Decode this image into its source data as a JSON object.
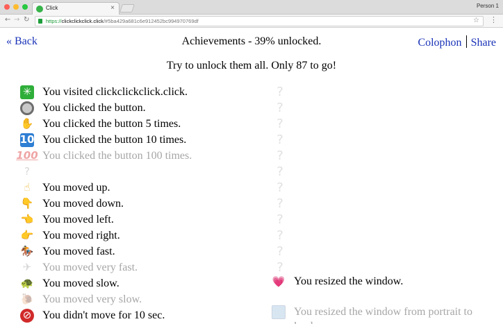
{
  "browser": {
    "tab_title": "Click",
    "tab_close": "×",
    "profile": "Person 1",
    "url_scheme": "https://",
    "url_host": "clickclickclick.click",
    "url_path": "/#5ba429a681c6e912452bc994970769df",
    "nav_back": "←",
    "nav_forward": "→",
    "nav_reload": "↻",
    "star": "☆",
    "menu": "⋮"
  },
  "header": {
    "back": "« Back",
    "title": "Achievements - 39% unlocked.",
    "colophon": "Colophon",
    "share": "Share"
  },
  "subtitle": "Try to unlock them all. Only 87 to go!",
  "achievements_left": [
    {
      "icon": "✳",
      "icon_name": "sparkle-icon",
      "cls": "sq-green",
      "label": "You visited clickclickclick.click.",
      "unlocked": true
    },
    {
      "icon": "",
      "icon_name": "radio-button-icon",
      "cls": "circ",
      "label": "You clicked the button.",
      "unlocked": true
    },
    {
      "icon": "✋",
      "icon_name": "raised-hand-icon",
      "cls": "hand",
      "label": "You clicked the button 5 times.",
      "unlocked": true
    },
    {
      "icon": "10",
      "icon_name": "keycap-ten-icon",
      "cls": "sq-blue",
      "label": "You clicked the button 10 times.",
      "unlocked": true
    },
    {
      "icon": "100",
      "icon_name": "hundred-points-icon",
      "cls": "hundred",
      "label": "You clicked the button 100 times.",
      "unlocked": false
    },
    {
      "icon": "?",
      "icon_name": "question-mark-icon",
      "cls": "grey",
      "label": "",
      "unlocked": false
    },
    {
      "icon": "☝",
      "icon_name": "pointing-up-icon",
      "cls": "hand",
      "label": "You moved up.",
      "unlocked": true
    },
    {
      "icon": "👇",
      "icon_name": "pointing-down-icon",
      "cls": "hand",
      "label": "You moved down.",
      "unlocked": true
    },
    {
      "icon": "👈",
      "icon_name": "pointing-left-icon",
      "cls": "hand",
      "label": "You moved left.",
      "unlocked": true
    },
    {
      "icon": "👉",
      "icon_name": "pointing-right-icon",
      "cls": "hand",
      "label": "You moved right.",
      "unlocked": true
    },
    {
      "icon": "🏇",
      "icon_name": "horse-racing-icon",
      "cls": "horse",
      "label": "You moved fast.",
      "unlocked": true
    },
    {
      "icon": "✈",
      "icon_name": "airplane-icon",
      "cls": "grey",
      "label": "You moved very fast.",
      "unlocked": false
    },
    {
      "icon": "🐢",
      "icon_name": "turtle-icon",
      "cls": "turtle",
      "label": "You moved slow.",
      "unlocked": true
    },
    {
      "icon": "🐌",
      "icon_name": "snail-icon",
      "cls": "grey",
      "label": "You moved very slow.",
      "unlocked": false
    },
    {
      "icon": "⊘",
      "icon_name": "no-pedestrians-icon",
      "cls": "red-circ",
      "label": "You didn't move for 10 sec.",
      "unlocked": true
    }
  ],
  "achievements_right": [
    {
      "icon": "💗",
      "icon_name": "growing-heart-icon",
      "cls": "pink",
      "label": "You resized the window.",
      "unlocked": true
    },
    {
      "icon": "",
      "icon_name": "framed-picture-icon",
      "cls": "frame",
      "label": "You resized the window from portrait to landscape.",
      "unlocked": false
    }
  ],
  "placeholder_glyph": "?"
}
